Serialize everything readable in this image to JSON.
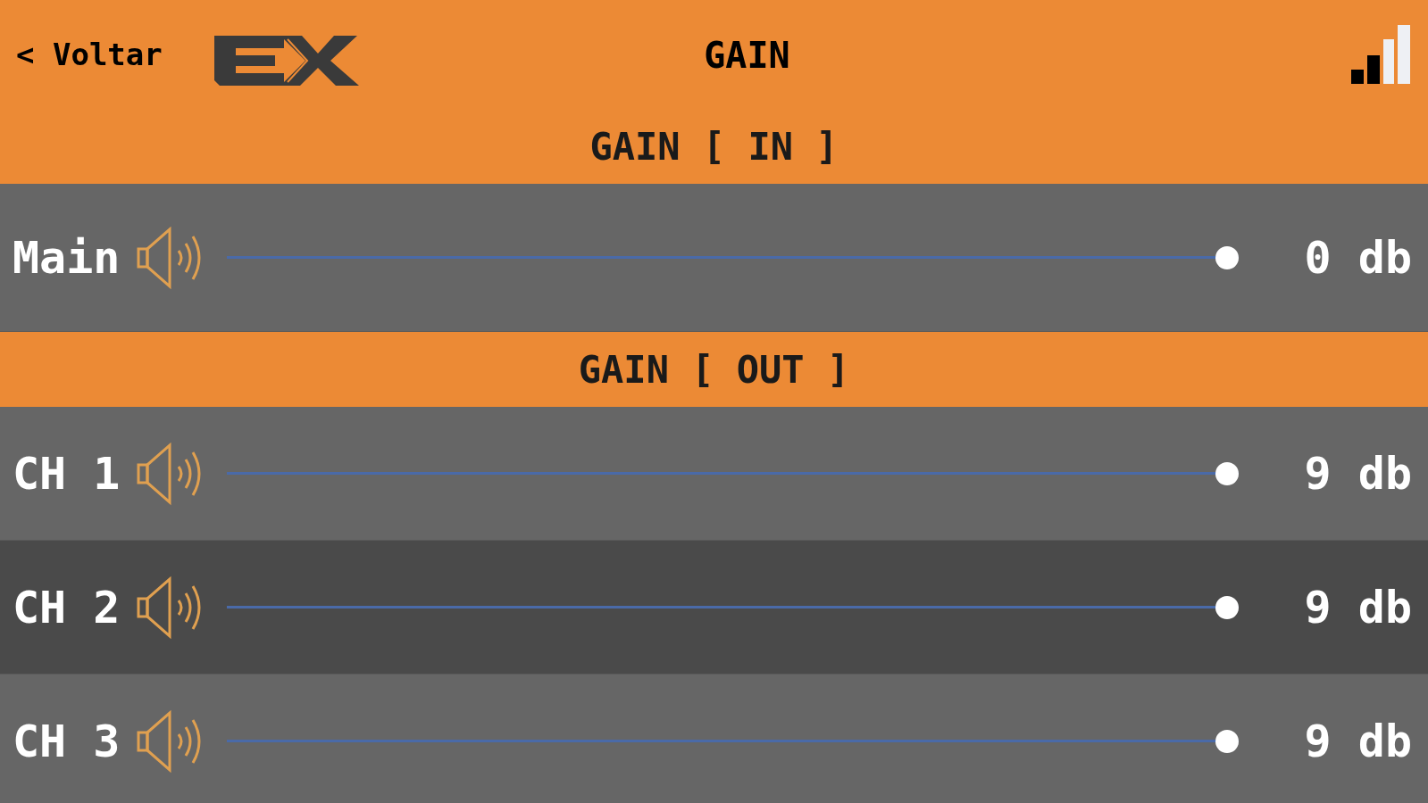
{
  "header": {
    "back": "< Voltar",
    "title": "GAIN"
  },
  "sections": [
    {
      "title": "GAIN [ IN ]",
      "channels": [
        {
          "name": "Main",
          "level": 1,
          "reading": "0 db",
          "highlighted": false
        }
      ]
    },
    {
      "title": "GAIN [ OUT ]",
      "channels": [
        {
          "name": "CH 1",
          "level": 1,
          "reading": "9 db",
          "highlighted": false
        },
        {
          "name": "CH 2",
          "level": 1,
          "reading": "9 db",
          "highlighted": true
        },
        {
          "name": "CH 3",
          "level": 1,
          "reading": "9 db",
          "highlighted": false
        }
      ]
    }
  ]
}
